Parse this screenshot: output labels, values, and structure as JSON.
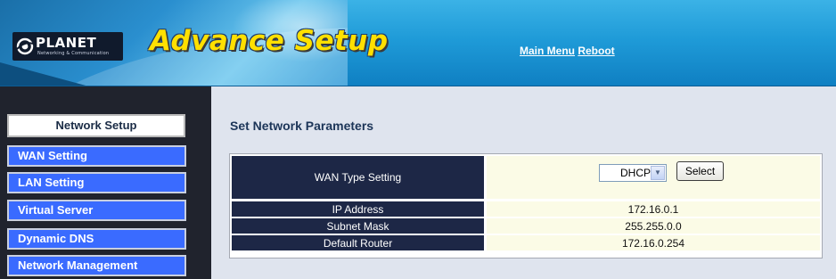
{
  "header": {
    "logo_text": "PLANET",
    "logo_subtext": "Networking & Communication",
    "title": "Advance Setup",
    "links": [
      "Main Menu",
      "Reboot"
    ]
  },
  "sidebar": {
    "header": "Network Setup",
    "items": [
      "WAN Setting",
      "LAN Setting",
      "Virtual Server",
      "Dynamic DNS",
      "Network Management"
    ]
  },
  "main": {
    "title": "Set Network Parameters",
    "wan_type": {
      "label": "WAN Type Setting",
      "selected": "DHCP",
      "button_label": "Select"
    },
    "rows": [
      {
        "label": "IP Address",
        "value": "172.16.0.1"
      },
      {
        "label": "Subnet Mask",
        "value": "255.255.0.0"
      },
      {
        "label": "Default Router",
        "value": "172.16.0.254"
      }
    ]
  },
  "colors": {
    "header_blue": "#1f9bd8",
    "title_yellow": "#ffe000",
    "sidebar_bg": "#20232d",
    "nav_item_blue": "#3a6bff",
    "label_cell_navy": "#1d2746",
    "value_cell_cream": "#fbfbe6",
    "content_bg": "#dfe4ee"
  }
}
